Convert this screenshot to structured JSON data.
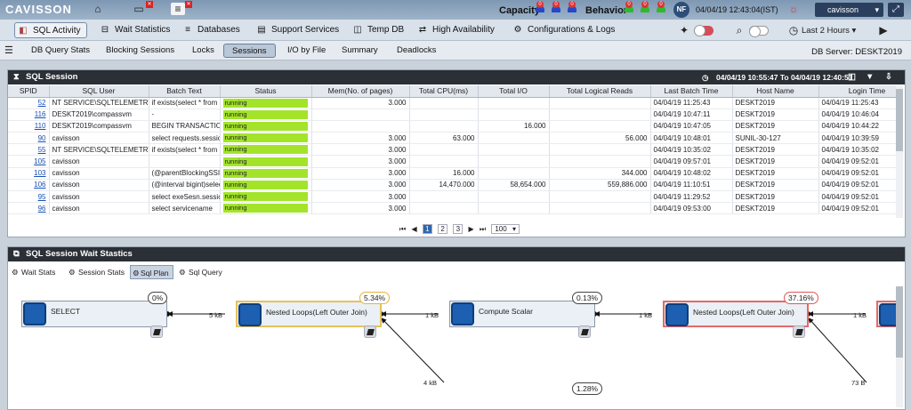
{
  "app": {
    "logo": "CAVISSON"
  },
  "top": {
    "capacity_label": "Capacity",
    "behavior_label": "Behavior",
    "capacity_counts": [
      "0",
      "0",
      "0"
    ],
    "behavior_counts": [
      "0",
      "0",
      "0"
    ],
    "avatar": "NF",
    "datetime": "04/04/19 12:43:04(IST)",
    "user": "cavisson"
  },
  "nav1": {
    "items": [
      "SQL Activity",
      "Wait Statistics",
      "Databases",
      "Support Services",
      "Temp DB",
      "High Availability",
      "Configurations & Logs"
    ],
    "time_range": "Last 2 Hours"
  },
  "nav2": {
    "items": [
      "DB Query Stats",
      "Blocking Sessions",
      "Locks",
      "Sessions",
      "I/O by File",
      "Summary",
      "Deadlocks"
    ],
    "db_server": "DB Server: DESKT2019"
  },
  "session_panel": {
    "title": "SQL Session",
    "range": "04/04/19 10:55:47 To 04/04/19 12:40:51",
    "columns": [
      "SPID",
      "SQL User",
      "Batch Text",
      "Status",
      "Mem(No. of pages)",
      "Total CPU(ms)",
      "Total I/O",
      "Total Logical Reads",
      "Last Batch Time",
      "Host Name",
      "Login Time"
    ],
    "rows": [
      [
        "52",
        "NT SERVICE\\SQLTELEMETRY",
        "if exists(select * from",
        "running",
        "3.000",
        "",
        "",
        "",
        "04/04/19 11:25:43",
        "DESKT2019",
        "04/04/19 11:25:43"
      ],
      [
        "116",
        "DESKT2019\\compassvm",
        "-",
        "running",
        "",
        "",
        "",
        "",
        "04/04/19 10:47:11",
        "DESKT2019",
        "04/04/19 10:46:04"
      ],
      [
        "110",
        "DESKT2019\\compassvm",
        "BEGIN TRANSACTION",
        "running",
        "",
        "",
        "16.000",
        "",
        "04/04/19 10:47:05",
        "DESKT2019",
        "04/04/19 10:44:22"
      ],
      [
        "90",
        "cavisson",
        "select requests.session",
        "running",
        "3.000",
        "63.000",
        "",
        "56.000",
        "04/04/19 10:48:01",
        "SUNIL-30-127",
        "04/04/19 10:39:59"
      ],
      [
        "55",
        "NT SERVICE\\SQLTELEMETRY",
        "if exists(select * from",
        "running",
        "3.000",
        "",
        "",
        "",
        "04/04/19 10:35:02",
        "DESKT2019",
        "04/04/19 10:35:02"
      ],
      [
        "105",
        "cavisson",
        "",
        "running",
        "3.000",
        "",
        "",
        "",
        "04/04/19 09:57:01",
        "DESKT2019",
        "04/04/19 09:52:01"
      ],
      [
        "103",
        "cavisson",
        "(@parentBlockingSSID",
        "running",
        "3.000",
        "16.000",
        "",
        "344.000",
        "04/04/19 10:48:02",
        "DESKT2019",
        "04/04/19 09:52:01"
      ],
      [
        "106",
        "cavisson",
        "(@interval bigint)select",
        "running",
        "3.000",
        "14,470.000",
        "58,654.000",
        "559,886.000",
        "04/04/19 11:10:51",
        "DESKT2019",
        "04/04/19 09:52:01"
      ],
      [
        "95",
        "cavisson",
        "select exeSesn.session",
        "running",
        "3.000",
        "",
        "",
        "",
        "04/04/19 11:29:52",
        "DESKT2019",
        "04/04/19 09:52:01"
      ],
      [
        "96",
        "cavisson",
        "select servicename",
        "running",
        "3.000",
        "",
        "",
        "",
        "04/04/19 09:53:00",
        "DESKT2019",
        "04/04/19 09:52:01"
      ]
    ],
    "pager": {
      "pages": [
        "1",
        "2",
        "3"
      ],
      "page_size": "100"
    }
  },
  "wait_panel": {
    "title": "SQL Session Wait Stastics",
    "tabs": [
      "Wait Stats",
      "Session Stats",
      "Sql Plan",
      "Sql Query"
    ],
    "nodes": [
      {
        "label": "SELECT",
        "pct": "0%"
      },
      {
        "label": "Nested Loops(Left Outer Join)",
        "pct": "5.34%"
      },
      {
        "label": "Compute Scalar",
        "pct": "0.13%"
      },
      {
        "label": "Nested Loops(Left Outer Join)",
        "pct": "37.16%"
      }
    ],
    "edges": [
      "5 kB",
      "1 kB",
      "1 kB",
      "1 kB",
      "4 kB",
      "73 B"
    ],
    "lower_pct": "1.28%"
  }
}
